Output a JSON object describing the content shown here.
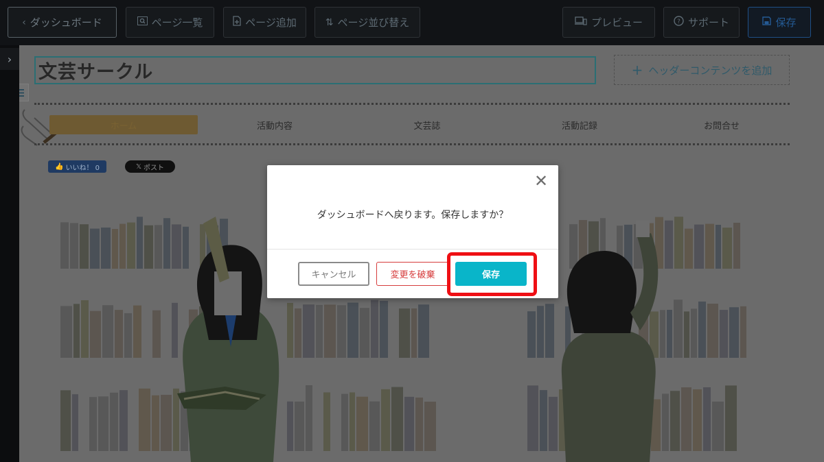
{
  "toolbar": {
    "back_label": "ダッシュボード",
    "page_list_label": "ページ一覧",
    "add_page_label": "ページ追加",
    "sort_pages_label": "ページ並び替え",
    "preview_label": "プレビュー",
    "support_label": "サポート",
    "save_label": "保存"
  },
  "site": {
    "title": "文芸サークル",
    "header_add_label": "ヘッダーコンテンツを追加",
    "nav": [
      "ホーム",
      "活動内容",
      "文芸誌",
      "活動記録",
      "お問合せ"
    ],
    "like_label": "いいね！ 0",
    "post_label": "ポスト"
  },
  "dialog": {
    "message": "ダッシュボードへ戻ります。保存しますか？",
    "cancel_label": "キャンセル",
    "discard_label": "変更を破棄",
    "save_label": "保存"
  },
  "colors": {
    "accent_save": "#09b5c9",
    "discard_red": "#d63b3b",
    "highlight_red": "#ef0f14",
    "toolbar_bg": "#111316"
  }
}
